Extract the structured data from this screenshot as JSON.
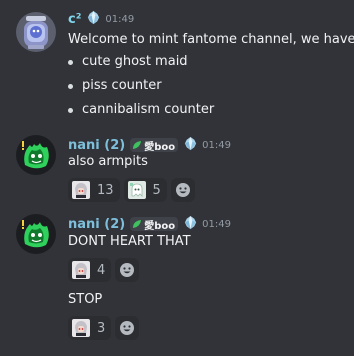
{
  "messages": [
    {
      "author": "c²",
      "time": "01:49",
      "text": "Welcome to mint fantome channel, we have:",
      "bullets": [
        "cute ghost maid",
        "piss counter",
        "cannibalism counter"
      ]
    },
    {
      "author": "nani (2)",
      "tag": "愛boo",
      "time": "01:49",
      "text": "also armpits",
      "reactions": [
        {
          "emoji": "maid-sticker-emoji",
          "count": "13"
        },
        {
          "emoji": "ghost-sticker-emoji",
          "count": "5"
        }
      ]
    },
    {
      "author": "nani (2)",
      "tag": "愛boo",
      "time": "01:49",
      "text": "DONT HEART THAT",
      "reactions": [
        {
          "emoji": "maid-sticker-emoji",
          "count": "4"
        }
      ],
      "followup_text": "STOP",
      "followup_reactions": [
        {
          "emoji": "maid-sticker-emoji",
          "count": "3"
        }
      ]
    }
  ],
  "icons": {
    "crystal": "crystal-badge-icon",
    "tag_icon": "green-leaf-icon",
    "add_reaction": "smiley-add-icon"
  },
  "colors": {
    "background": "#313338",
    "name_c": "#80d6ea",
    "name_nani": "#7ec0dc",
    "timestamp": "#949ba4",
    "reaction_bg": "#2b2d31",
    "tag_bg": "#3f4248"
  }
}
